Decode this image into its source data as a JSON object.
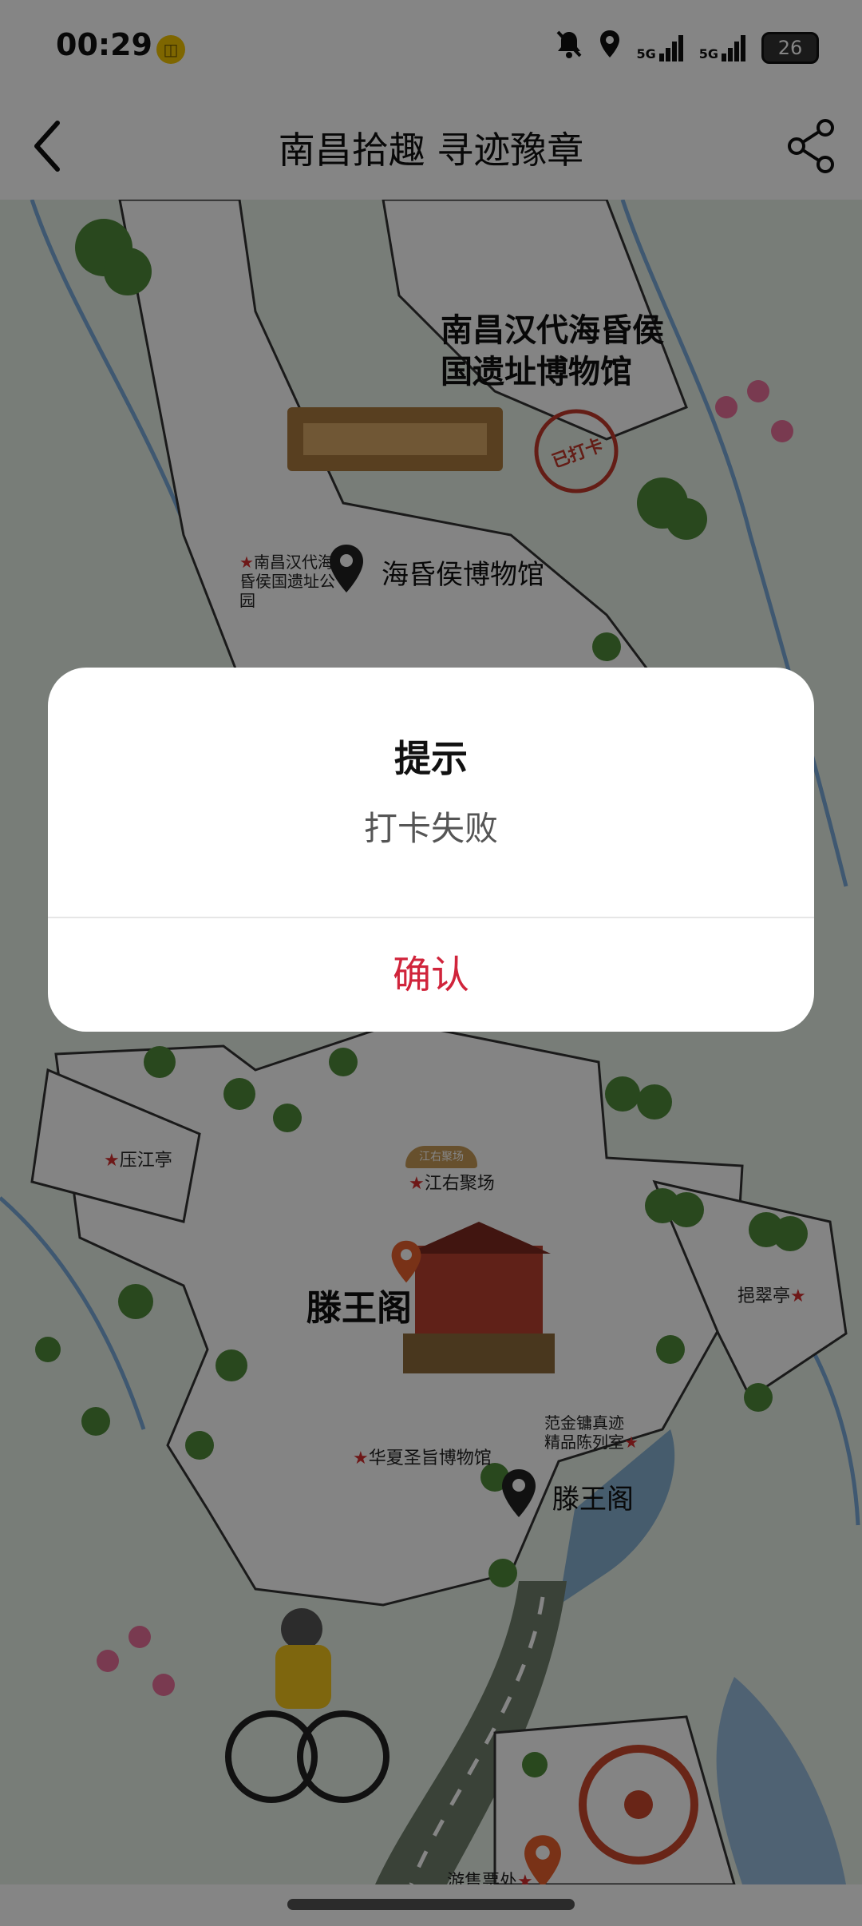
{
  "status_bar": {
    "time": "00:29",
    "network_1": "5G",
    "network_2": "5G",
    "battery": "26",
    "icons": [
      "notification-app-icon",
      "mute-bell-icon",
      "location-icon",
      "signal-icon",
      "signal-icon",
      "battery-icon"
    ]
  },
  "header": {
    "title": "南昌拾趣 寻迹豫章",
    "back_icon": "chevron-left-icon",
    "share_icon": "share-icon"
  },
  "map": {
    "landmarks": [
      {
        "name": "南昌汉代海昏侯\n国遗址博物馆",
        "stamp": "已打卡"
      },
      {
        "name": "滕王阁"
      }
    ],
    "markers": [
      {
        "label": "海昏侯博物馆"
      },
      {
        "label": "滕王阁"
      }
    ],
    "poi": {
      "park": "南昌汉代海昏侯国遗址公园",
      "yajiang": "压江亭",
      "jiangyou": "江右聚场",
      "jiangyou_sign": "江右聚场",
      "yacui": "挹翠亭",
      "fanjin": "范金镛真迹\n精品陈列室",
      "huaxia": "华夏圣旨博物馆",
      "tickets": "游售票处"
    }
  },
  "dialog": {
    "title": "提示",
    "message": "打卡失败",
    "confirm": "确认"
  },
  "colors": {
    "accent": "#d0243b",
    "overlay": "rgba(0,0,0,0.48)",
    "map_bg": "#e7f0e7",
    "river": "#7aa9d8"
  }
}
